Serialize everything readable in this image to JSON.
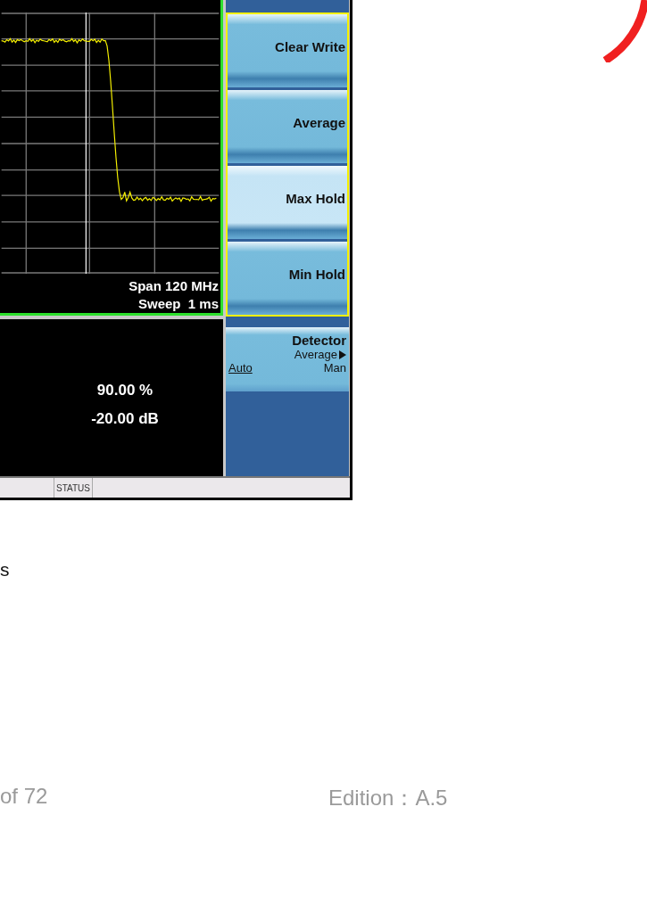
{
  "analyzer": {
    "display": {
      "span": "Span 120 MHz",
      "sweep": "Sweep  1 ms"
    },
    "results": [
      "90.00 %",
      "-20.00 dB"
    ],
    "softkeys": [
      {
        "kind": "button",
        "label": "Clear Write",
        "selected": false
      },
      {
        "kind": "button",
        "label": "Average",
        "selected": false
      },
      {
        "kind": "button",
        "label": "Max Hold",
        "selected": true
      },
      {
        "kind": "button",
        "label": "Min Hold",
        "selected": false
      },
      {
        "kind": "toggle",
        "label": "Detector",
        "value": "Average",
        "options": [
          {
            "label": "Auto",
            "selected": true
          },
          {
            "label": "Man",
            "selected": false
          }
        ]
      }
    ],
    "status_bar": {
      "label": "STATUS"
    }
  },
  "document": {
    "body_text": "s",
    "page": "of  72",
    "edition": "Edition：A.5"
  }
}
